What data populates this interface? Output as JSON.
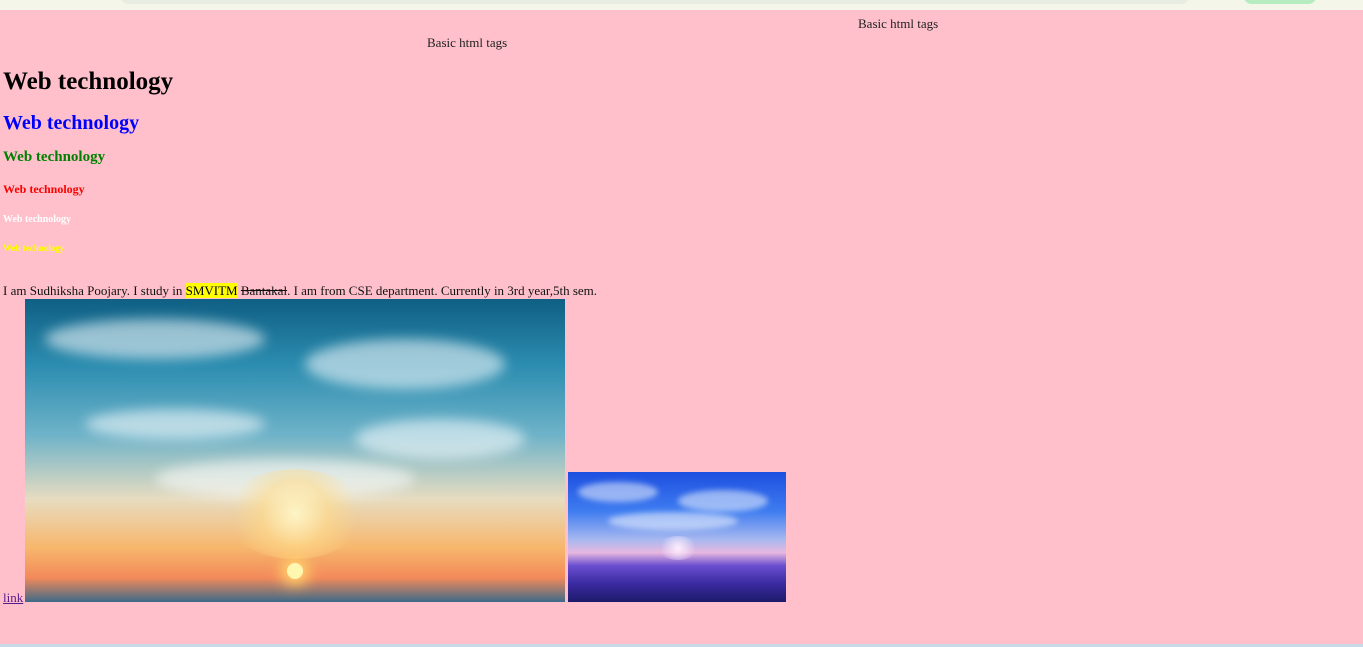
{
  "marquee": {
    "top_text": "Basic html tags",
    "second_text": "Basic html tags"
  },
  "headings": {
    "h1": "Web technology",
    "h2": "Web technology",
    "h3": "Web technology",
    "h4": "Web technology",
    "h5": "Web technology",
    "h6": "Web technology"
  },
  "paragraph": {
    "before": "I am Sudhiksha Poojary. I study in ",
    "highlighted": "SMVITM",
    "struck": "Bantakal",
    "after": ". I am from CSE department. Currently in 3rd year,5th sem."
  },
  "link": {
    "label": "link"
  },
  "colors": {
    "page_background": "#ffc0cb",
    "h1": "#000000",
    "h2": "#0000ff",
    "h3": "#008000",
    "h4": "#ff0000",
    "h5": "#ffffff",
    "h6": "#ffff00",
    "highlight": "#ffff00",
    "link": "#551a8b"
  }
}
